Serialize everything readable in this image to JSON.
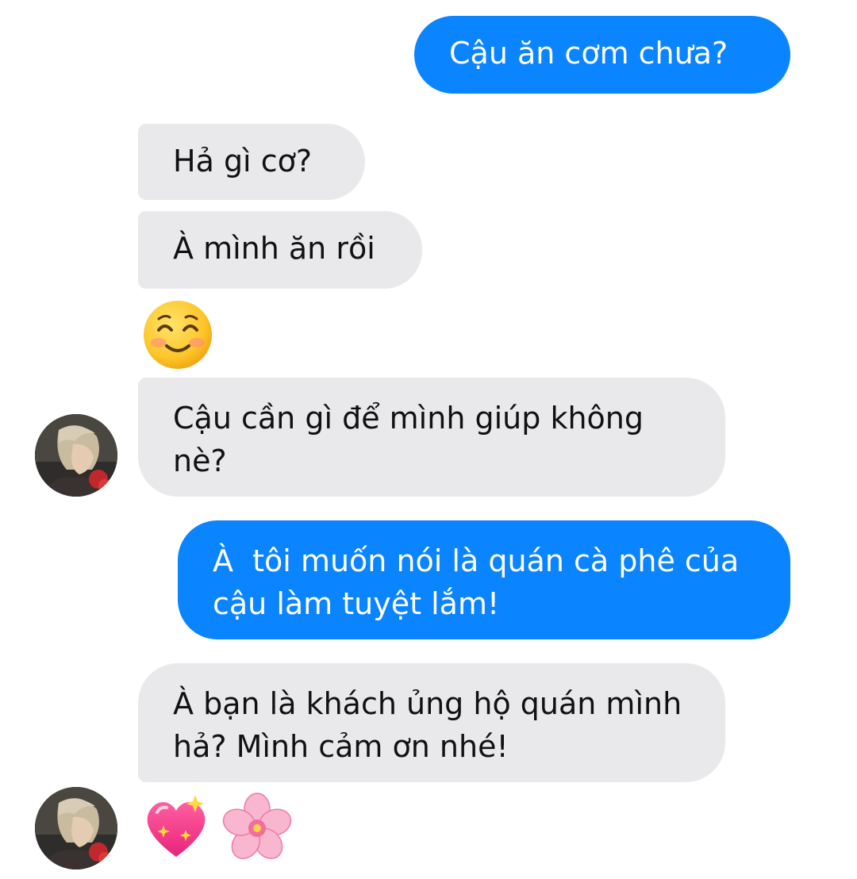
{
  "messages": [
    {
      "id": "m1",
      "direction": "outgoing",
      "text": "Cậu ăn cơm chưa?"
    },
    {
      "id": "m2",
      "direction": "incoming",
      "text": "Hả gì cơ?"
    },
    {
      "id": "m3",
      "direction": "incoming",
      "text": "À mình ăn rồi"
    },
    {
      "id": "m4",
      "direction": "incoming",
      "emoji": "smiling-face-with-smiling-eyes"
    },
    {
      "id": "m5",
      "direction": "incoming",
      "text": "Cậu cần gì để mình giúp không nè?"
    },
    {
      "id": "m6",
      "direction": "outgoing",
      "text": "À  tôi muốn nói là quán cà phê của cậu làm tuyệt lắm!"
    },
    {
      "id": "m7",
      "direction": "incoming",
      "text": "À bạn là khách ủng hộ quán mình hả? Mình cảm ơn nhé!"
    },
    {
      "id": "m8",
      "direction": "incoming",
      "emoji": [
        "sparkling-heart",
        "cherry-blossom"
      ]
    }
  ],
  "colors": {
    "outgoing_bubble": "#0a84ff",
    "incoming_bubble": "#e9e9eb",
    "outgoing_text": "#ffffff",
    "incoming_text": "#111111"
  }
}
